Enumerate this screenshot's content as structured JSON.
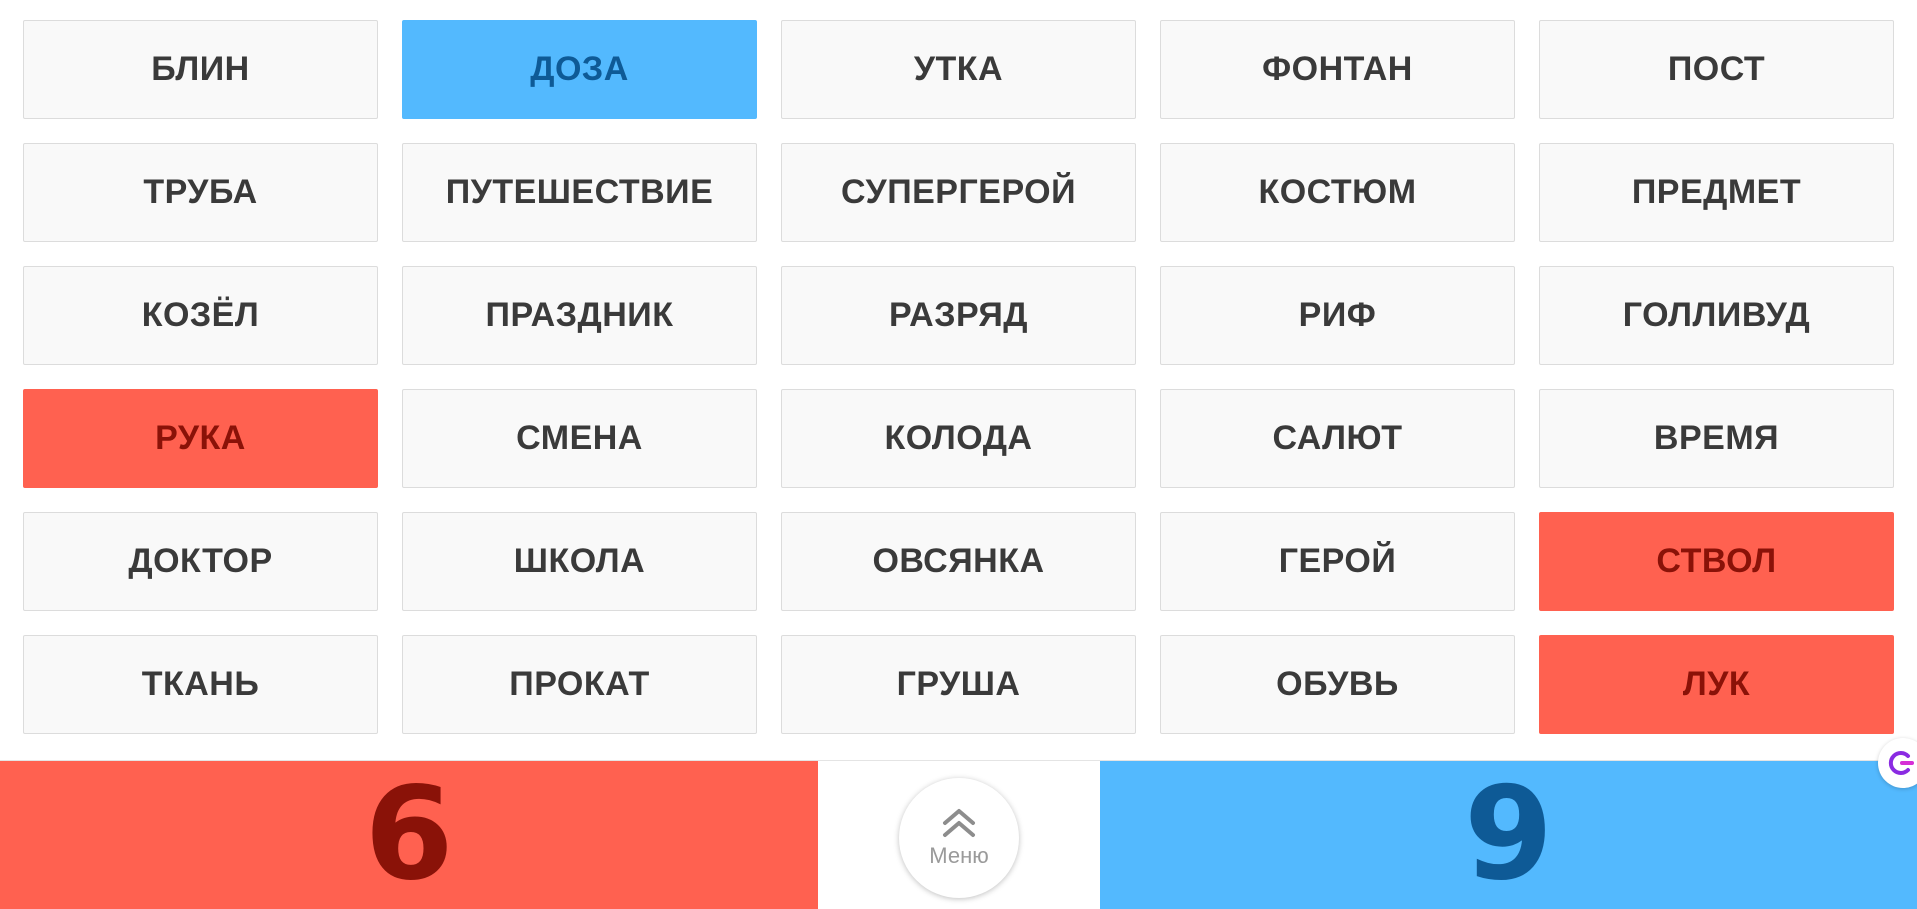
{
  "board": {
    "cards": [
      {
        "word": "БЛИН",
        "state": "neutral"
      },
      {
        "word": "ДОЗА",
        "state": "blue"
      },
      {
        "word": "УТКА",
        "state": "neutral"
      },
      {
        "word": "ФОНТАН",
        "state": "neutral"
      },
      {
        "word": "ПОСТ",
        "state": "neutral"
      },
      {
        "word": "ТРУБА",
        "state": "neutral"
      },
      {
        "word": "ПУТЕШЕСТВИЕ",
        "state": "neutral"
      },
      {
        "word": "СУПЕРГЕРОЙ",
        "state": "neutral"
      },
      {
        "word": "КОСТЮМ",
        "state": "neutral"
      },
      {
        "word": "ПРЕДМЕТ",
        "state": "neutral"
      },
      {
        "word": "КОЗЁЛ",
        "state": "neutral"
      },
      {
        "word": "ПРАЗДНИК",
        "state": "neutral"
      },
      {
        "word": "РАЗРЯД",
        "state": "neutral"
      },
      {
        "word": "РИФ",
        "state": "neutral"
      },
      {
        "word": "ГОЛЛИВУД",
        "state": "neutral"
      },
      {
        "word": "РУКА",
        "state": "red"
      },
      {
        "word": "СМЕНА",
        "state": "neutral"
      },
      {
        "word": "КОЛОДА",
        "state": "neutral"
      },
      {
        "word": "САЛЮТ",
        "state": "neutral"
      },
      {
        "word": "ВРЕМЯ",
        "state": "neutral"
      },
      {
        "word": "ДОКТОР",
        "state": "neutral"
      },
      {
        "word": "ШКОЛА",
        "state": "neutral"
      },
      {
        "word": "ОВСЯНКА",
        "state": "neutral"
      },
      {
        "word": "ГЕРОЙ",
        "state": "neutral"
      },
      {
        "word": "СТВОЛ",
        "state": "red"
      },
      {
        "word": "ТКАНЬ",
        "state": "neutral"
      },
      {
        "word": "ПРОКАТ",
        "state": "neutral"
      },
      {
        "word": "ГРУША",
        "state": "neutral"
      },
      {
        "word": "ОБУВЬ",
        "state": "neutral"
      },
      {
        "word": "ЛУК",
        "state": "red"
      }
    ]
  },
  "scores": {
    "red": "6",
    "blue": "9"
  },
  "menu": {
    "label": "Меню",
    "icon": "double-chevron-up-icon"
  },
  "colors": {
    "red_team": "#ff6150",
    "blue_team": "#53b9fe",
    "neutral_card": "#f9f9f9"
  }
}
